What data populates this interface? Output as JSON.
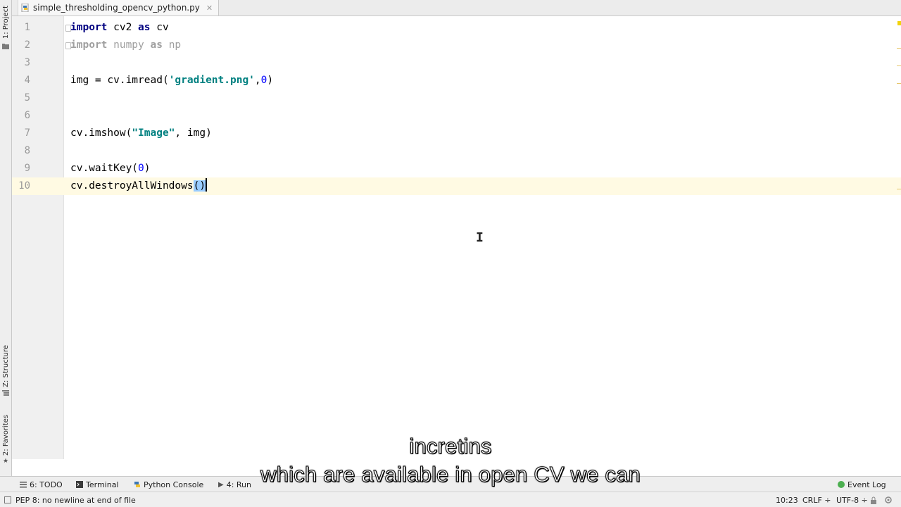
{
  "sidebar_tabs": {
    "project": "1: Project",
    "structure": "Z: Structure",
    "favorites": "2: Favorites"
  },
  "editor_tab": {
    "filename": "simple_thresholding_opencv_python.py"
  },
  "code_lines": [
    {
      "n": "1",
      "segments": [
        [
          "kw",
          "import"
        ],
        [
          "plain",
          " cv2 "
        ],
        [
          "kw",
          "as"
        ],
        [
          "plain",
          " cv"
        ]
      ]
    },
    {
      "n": "2",
      "segments": [
        [
          "kw-dim",
          "import"
        ],
        [
          "dim",
          " numpy "
        ],
        [
          "kw-dim",
          "as"
        ],
        [
          "dim",
          " np"
        ]
      ]
    },
    {
      "n": "3",
      "segments": []
    },
    {
      "n": "4",
      "segments": [
        [
          "plain",
          "img = cv.imread("
        ],
        [
          "str",
          "'gradient.png'"
        ],
        [
          "plain",
          ","
        ],
        [
          "num",
          "0"
        ],
        [
          "plain",
          ")"
        ]
      ]
    },
    {
      "n": "5",
      "segments": []
    },
    {
      "n": "6",
      "segments": []
    },
    {
      "n": "7",
      "segments": [
        [
          "plain",
          "cv.imshow("
        ],
        [
          "str",
          "\"Image\""
        ],
        [
          "plain",
          ", img)"
        ]
      ]
    },
    {
      "n": "8",
      "segments": []
    },
    {
      "n": "9",
      "segments": [
        [
          "plain",
          "cv.waitKey("
        ],
        [
          "num",
          "0"
        ],
        [
          "plain",
          ")"
        ]
      ]
    },
    {
      "n": "10",
      "segments": [
        [
          "plain",
          "cv.destroyAllWindows"
        ],
        [
          "match",
          "()"
        ]
      ]
    }
  ],
  "bottom_tools": {
    "todo": "6: TODO",
    "terminal": "Terminal",
    "python_console": "Python Console",
    "run": "4: Run",
    "event_log": "Event Log"
  },
  "status": {
    "message": "PEP 8: no newline at end of file",
    "position": "10:23",
    "line_sep": "CRLF ÷",
    "encoding": "UTF-8 ÷"
  },
  "captions": {
    "line1": "incretins",
    "line2": "which are available in open CV we can"
  },
  "colors": {
    "keyword": "#000080",
    "string": "#008080",
    "number": "#0000ff",
    "current_line": "#fffae3",
    "bracket_match": "#99ccff"
  }
}
